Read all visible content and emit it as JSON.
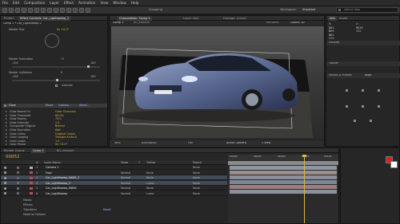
{
  "app": {
    "menu": [
      "File",
      "Edit",
      "Composition",
      "Layer",
      "Effect",
      "Animation",
      "View",
      "Window",
      "Help"
    ],
    "workspace_label": "Workspace:",
    "workspace_value": "Standard",
    "search_placeholder": "Search Help",
    "snapping": "Snapping"
  },
  "effect_controls": {
    "tabs": [
      "Project",
      "Effect Controls: Car_Lightsweep_2"
    ],
    "path": "Comp 1 • Car_LightSweep 2",
    "feather_row": {
      "name": "Master Hue",
      "value": "0x +0.0°"
    },
    "saturation": {
      "name": "Master Saturation",
      "value": "71",
      "min": "-100",
      "max": "100"
    },
    "lightness": {
      "name": "Master Lightness",
      "value": "0",
      "min": "-100",
      "max": "100"
    },
    "colorize_label": "Colorize",
    "glow_header": "Glow",
    "glow_reset": "Reset",
    "glow_options": "Options...",
    "glow_about": "About...",
    "glow_rows": [
      {
        "name": "Glow Based On",
        "value": "Color Channels"
      },
      {
        "name": "Glow Threshold",
        "value": "60.0%"
      },
      {
        "name": "Glow Radius",
        "value": "73.0"
      },
      {
        "name": "Glow Intensity",
        "value": "2.5"
      },
      {
        "name": "Composite Original",
        "value": "Behind"
      },
      {
        "name": "Glow Operation",
        "value": "Add"
      },
      {
        "name": "Glow Colors",
        "value": "Original Colors"
      },
      {
        "name": "Color Looping",
        "value": "Triangle A>B>A"
      },
      {
        "name": "Color Loops",
        "value": "1.0"
      },
      {
        "name": "Color Phase",
        "value": "0x +0.0°"
      }
    ]
  },
  "composition": {
    "tabs": [
      "Composition: Comp 1",
      "Layer: Null",
      "Footage: (none)"
    ],
    "subtabs": [
      "Comp 1",
      "BG_network"
    ],
    "active_camera": "Active Camera",
    "renderer_label": "Renderer:",
    "renderer_value": "Classic 3D",
    "zoom": "50%",
    "timecode": "0;00;00;00",
    "resolution": "Full",
    "view": "Active Camera",
    "views": "1 View"
  },
  "right_panels": {
    "info_tab": "Info",
    "audio_tab": "Audio",
    "info_lines": [
      "R: 224",
      "G: 226",
      "B: 193",
      "A: 255"
    ],
    "info_coords": [
      "X: 1036",
      "Y: 132"
    ],
    "preview_tab": "Preview",
    "effects_tab": "Effects & Presets",
    "tracker_tab": "Tracker",
    "align_tab": "Align"
  },
  "timeline": {
    "tabs": [
      "Render Queue",
      "Comp 1",
      "BG_network"
    ],
    "timecode": "00052",
    "columns": [
      "#",
      "Layer Name",
      "Mode",
      "T",
      "TrkMat",
      "Parent"
    ],
    "layers": [
      {
        "num": "1",
        "name": "Camera 1",
        "mode": "",
        "trkmat": "",
        "parent": "None",
        "color": "#a9b2c2"
      },
      {
        "num": "2",
        "name": "Fowl",
        "mode": "Normal",
        "trkmat": "None",
        "parent": "None",
        "color": "#c24c4c"
      },
      {
        "num": "3",
        "name": "Car_LightSweep_MASK_2",
        "mode": "Normal",
        "trkmat": "None",
        "parent": "None",
        "color": "#c24c4c"
      },
      {
        "num": "4",
        "name": "Car_LightSweep_2",
        "mode": "Normal",
        "trkmat": "Luma",
        "parent": "None",
        "color": "#c24c4c"
      },
      {
        "num": "5",
        "name": "Car_LightSweep_MASK",
        "mode": "Normal",
        "trkmat": "None",
        "parent": "None",
        "color": "#c24c4c"
      },
      {
        "num": "6",
        "name": "Car_LightSweep",
        "mode": "Normal",
        "trkmat": "Luma",
        "parent": "None",
        "color": "#c24c4c"
      }
    ],
    "sublines": [
      "Masks",
      "Effects",
      "Transform",
      "Material Options"
    ],
    "reset_label": "Reset",
    "ruler": [
      "00000",
      "00025",
      "00050",
      "00075",
      "00100"
    ]
  },
  "colors": {
    "playhead": "#e0b43a",
    "fg_swatch": "#e02020",
    "bg_swatch": "#ffffff"
  }
}
